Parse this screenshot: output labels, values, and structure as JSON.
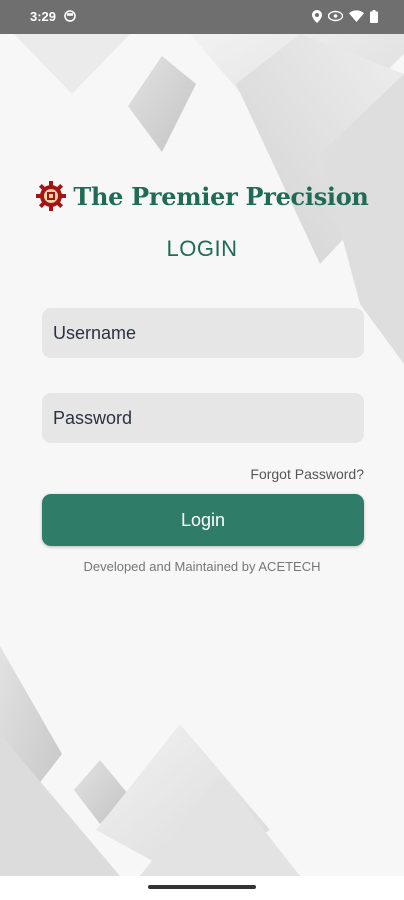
{
  "status_bar": {
    "time": "3:29",
    "icons": [
      "app-notification-icon",
      "location-icon",
      "vpn-key-icon",
      "wifi-icon",
      "battery-icon"
    ]
  },
  "brand": {
    "name": "The Premier Precision",
    "logo_icon": "gear-emblem-icon",
    "color": "#1f6b55",
    "logo_color": "#a51414"
  },
  "login": {
    "title": "LOGIN",
    "username_placeholder": "Username",
    "password_placeholder": "Password",
    "forgot_password": "Forgot Password?",
    "button_label": "Login",
    "button_color": "#2f7c68"
  },
  "footer": {
    "credit": "Developed and Maintained by ACETECH"
  }
}
